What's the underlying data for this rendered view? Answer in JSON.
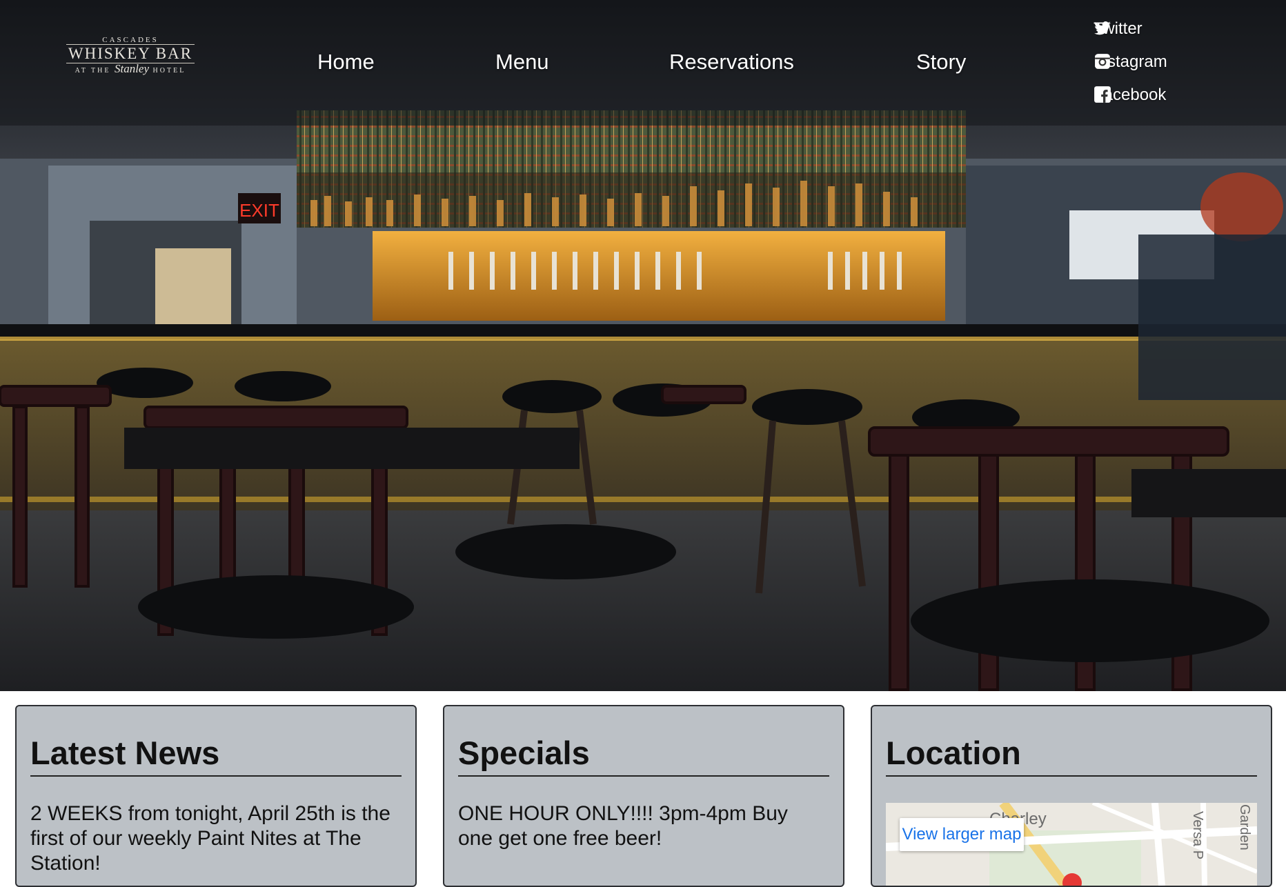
{
  "logo": {
    "top_text": "CASCADES",
    "main_text": "WHISKEY BAR",
    "sub_prefix": "AT THE",
    "sub_script": "Stanley",
    "sub_suffix": "HOTEL"
  },
  "nav": {
    "items": [
      {
        "label": "Home"
      },
      {
        "label": "Menu"
      },
      {
        "label": "Reservations"
      },
      {
        "label": "Story"
      }
    ]
  },
  "social": {
    "items": [
      {
        "label": "Twitter",
        "icon": "twitter-icon"
      },
      {
        "label": "Instagram",
        "icon": "instagram-icon"
      },
      {
        "label": "Facebook",
        "icon": "facebook-icon"
      }
    ]
  },
  "hero": {
    "exit_sign": "EXIT"
  },
  "cards": {
    "news": {
      "title": "Latest News",
      "body": "2 WEEKS from tonight, April 25th is the first of our weekly Paint Nites at The Station!"
    },
    "specials": {
      "title": "Specials",
      "body": "ONE HOUR ONLY!!!! 3pm-4pm Buy one get one free beer!"
    },
    "location": {
      "title": "Location",
      "map_button": "View larger map",
      "map_street": "Charley",
      "map_street_2": "Versa P",
      "map_street_3": "Garden"
    }
  },
  "colors": {
    "card_bg": "#bcc1c6",
    "map_link": "#1a73e8"
  }
}
